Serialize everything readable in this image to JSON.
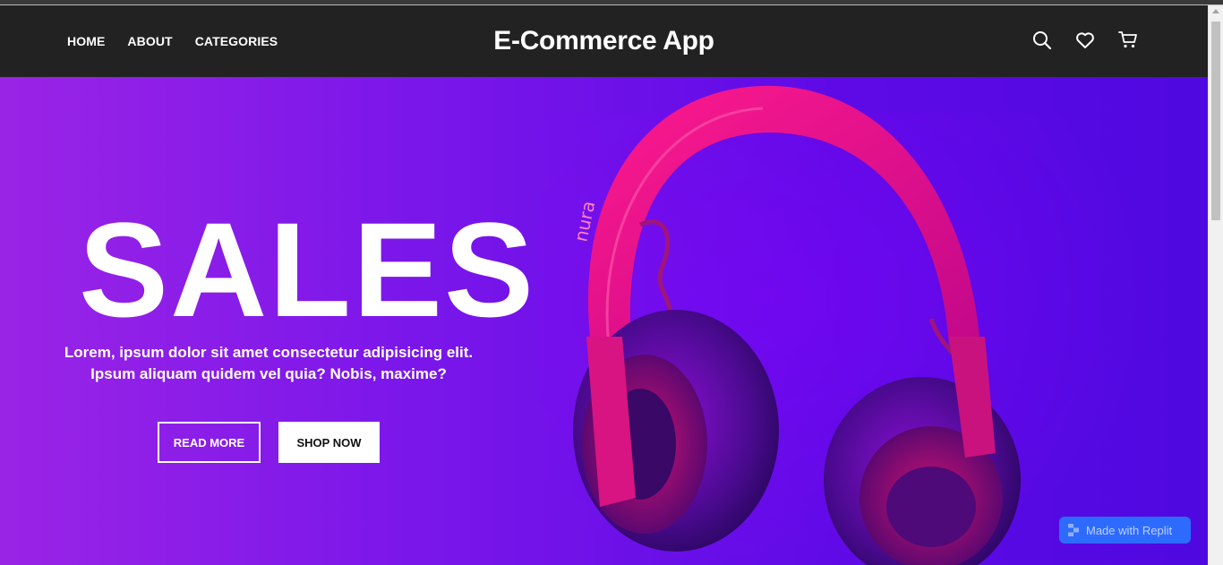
{
  "nav": {
    "links": [
      {
        "label": "HOME"
      },
      {
        "label": "ABOUT"
      },
      {
        "label": "CATEGORIES"
      }
    ],
    "brand": "E-Commerce App",
    "icons": [
      "search-icon",
      "heart-icon",
      "cart-icon"
    ]
  },
  "hero": {
    "title": "SALES",
    "description": "Lorem, ipsum dolor sit amet consectetur adipisicing elit. Ipsum aliquam quidem vel quia? Nobis, maxime?",
    "read_more_label": "READ MORE",
    "shop_now_label": "SHOP NOW",
    "product_brand": "nura"
  },
  "badge": {
    "label": "Made with Replit"
  },
  "colors": {
    "navbar": "#222222",
    "hero_start": "#9a24e6",
    "hero_end": "#4f08e0",
    "headphone_pink": "#e0107a",
    "badge": "#2d6bff"
  }
}
